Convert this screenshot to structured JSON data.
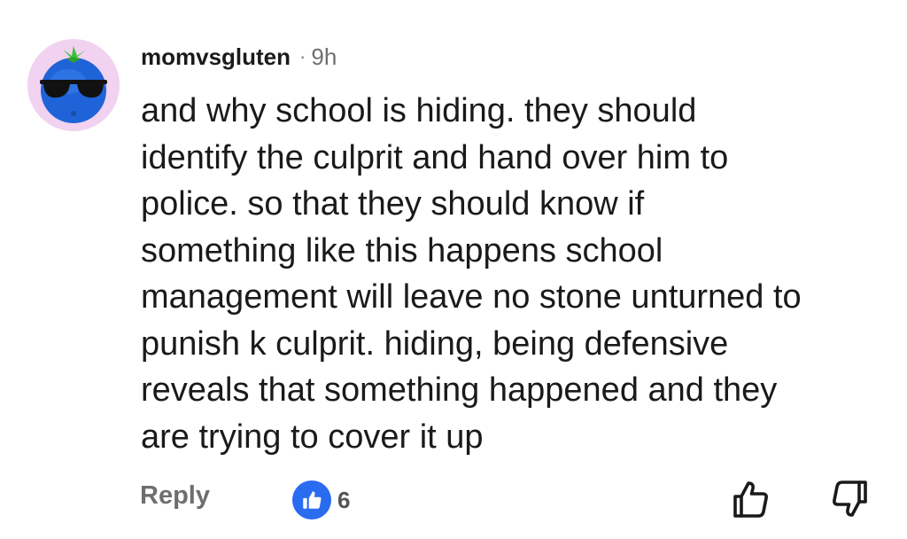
{
  "comment": {
    "username": "momvsgluten",
    "separator": "·",
    "time": "9h",
    "body_lines": [
      "and why school is hiding. they should",
      "identify the culprit and hand over him to",
      "police. so that they should know if",
      "something like this happens school",
      "management will leave no stone unturned to",
      "punish k culprit. hiding, being defensive",
      "reveals that something happened and they",
      "are trying to cover it up"
    ],
    "avatar_icon": "blueberry-sunglasses-avatar",
    "avatar_bg": "#f1d2f0"
  },
  "actions": {
    "reply_label": "Reply",
    "like_count": "6",
    "like_badge_color": "#2a6cf0",
    "like_badge_icon": "thumbs-up-icon",
    "upvote_icon": "thumbs-up-outline-icon",
    "downvote_icon": "thumbs-down-outline-icon"
  }
}
